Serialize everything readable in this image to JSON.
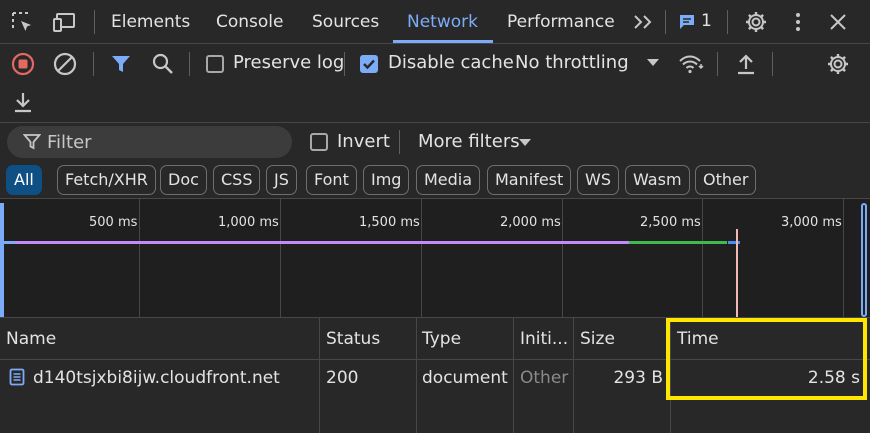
{
  "tabs": [
    {
      "label": "Elements"
    },
    {
      "label": "Console"
    },
    {
      "label": "Sources"
    },
    {
      "label": "Network"
    },
    {
      "label": "Performance"
    }
  ],
  "active_tab": "Network",
  "issues_badge": {
    "count": "1"
  },
  "toolbar": {
    "preserve_log": {
      "label": "Preserve log",
      "checked": false
    },
    "disable_cache": {
      "label": "Disable cache",
      "checked": true
    },
    "throttling": "No throttling"
  },
  "filter": {
    "placeholder": "Filter",
    "invert_label": "Invert",
    "more_filters_label": "More filters"
  },
  "type_filters": [
    "All",
    "Fetch/XHR",
    "Doc",
    "CSS",
    "JS",
    "Font",
    "Img",
    "Media",
    "Manifest",
    "WS",
    "Wasm",
    "Other"
  ],
  "active_type_filter": "All",
  "overview": {
    "ticks": [
      "500 ms",
      "1,000 ms",
      "1,500 ms",
      "2,000 ms",
      "2,500 ms",
      "3,000 ms"
    ]
  },
  "table": {
    "columns": [
      "Name",
      "Status",
      "Type",
      "Initi...",
      "Size",
      "Time"
    ],
    "rows": [
      {
        "name": "d140tsjxbi8ijw.cloudfront.net",
        "status": "200",
        "type": "document",
        "initiator": "Other",
        "size": "293 B",
        "time": "2.58 s"
      }
    ]
  },
  "colors": {
    "accent": "#7cacf8",
    "highlight": "#ffe600",
    "record_stop": "#e46962",
    "active_chip": "#0e4f84"
  }
}
